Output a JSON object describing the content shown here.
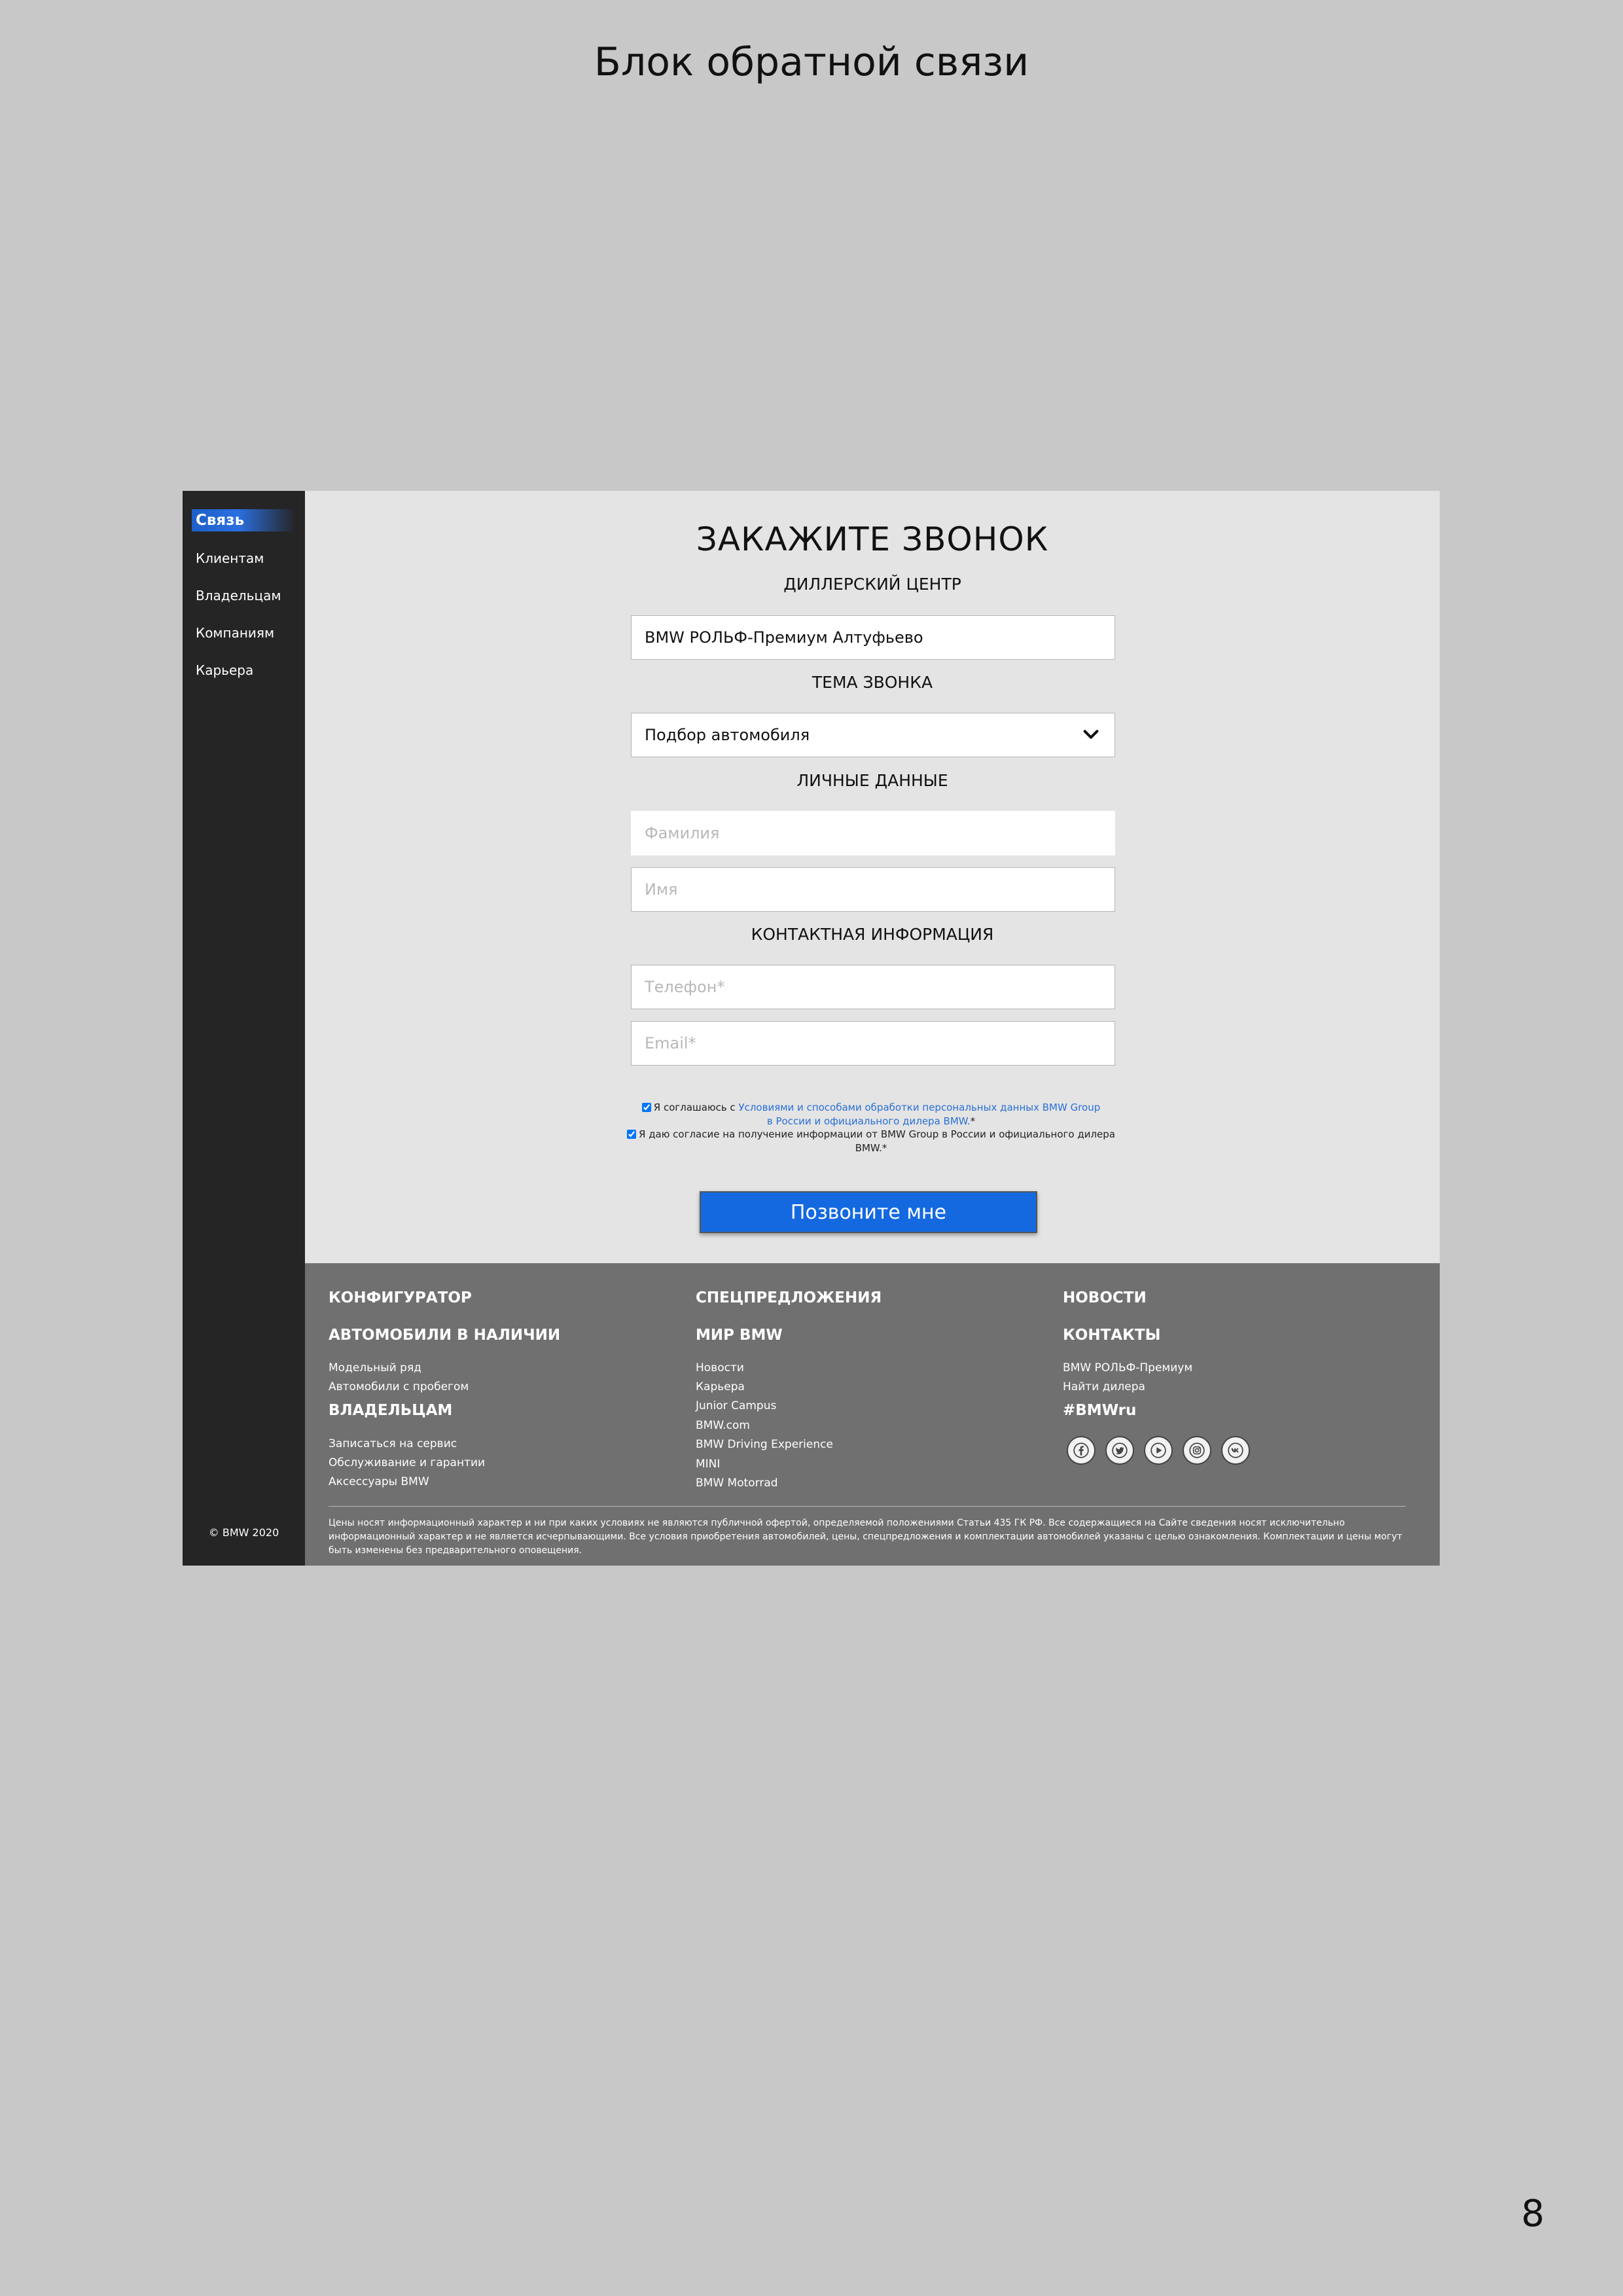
{
  "document": {
    "title": "Блок обратной связи",
    "page_number": "8"
  },
  "sidebar": {
    "active": "Связь",
    "items": [
      "Клиентам",
      "Владельцам",
      "Компаниям",
      "Карьера"
    ],
    "copyright": "© BMW 2020"
  },
  "form": {
    "title": "ЗАКАЖИТЕ ЗВОНОК",
    "dealer_label": "ДИЛЛЕРСКИЙ ЦЕНТР",
    "dealer_value": "BMW РОЛЬФ-Премиум Алтуфьево",
    "topic_label": "ТЕМА ЗВОНКА",
    "topic_value": "Подбор автомобиля",
    "personal_label": "ЛИЧНЫЕ ДАННЫЕ",
    "surname_placeholder": "Фамилия",
    "name_placeholder": "Имя",
    "contact_label": "КОНТАКТНАЯ ИНФОРМАЦИЯ",
    "phone_placeholder": "Телефон*",
    "email_placeholder": "Email*",
    "consent1_prefix": "Я соглашаюсь с ",
    "consent1_link_a": "Условиями и способами обработки персональных данных BMW Group",
    "consent1_link_b": "в России и официального дилера BMW.",
    "consent1_suffix": "*",
    "consent2_a": "Я даю согласие на получение информации от BMW Group в России и официального дилера",
    "consent2_b": "BMW.*",
    "submit": "Позвоните мне"
  },
  "footer": {
    "col1": {
      "h1": "КОНФИГУРАТОР",
      "h2": "АВТОМОБИЛИ В НАЛИЧИИ",
      "links_a": [
        "Модельный ряд",
        "Автомобили с пробегом"
      ],
      "h3": "ВЛАДЕЛЬЦАМ",
      "links_b": [
        "Записаться на сервис",
        "Обслуживание и гарантии",
        "Аксессуары BMW"
      ]
    },
    "col2": {
      "h1": "СПЕЦПРЕДЛОЖЕНИЯ",
      "h2": "МИР BMW",
      "links": [
        "Новости",
        "Карьера",
        "Junior Campus",
        "BMW.com",
        "BMW Driving Experience",
        "MINI",
        "BMW Motorrad"
      ]
    },
    "col3": {
      "h1": "НОВОСТИ",
      "h2": "КОНТАКТЫ",
      "links": [
        "BMW РОЛЬФ-Премиум",
        "Найти дилера"
      ],
      "hashtag": "#BMWru"
    },
    "socials": [
      "facebook-icon",
      "twitter-icon",
      "youtube-icon",
      "instagram-icon",
      "vk-icon"
    ],
    "disclaimer": "Цены носят информационный характер и ни при каких условиях не являются публичной офертой, определяемой положениями Статьи 435 ГК РФ. Все содержащиеся на Сайте сведения носят исключительно информационный характер и не является исчерпывающими. Все условия приобретения автомобилей, цены, спецпредложения и комплектации автомобилей указаны с целью ознакомления. Комплектации и цены могут быть изменены без предварительного оповещения."
  },
  "colors": {
    "page_bg": "#c8c8c8",
    "sidebar_bg": "#252525",
    "form_bg": "#e4e4e4",
    "footer_bg": "#707070",
    "accent": "#1469e0",
    "link": "#2a6fd6"
  }
}
